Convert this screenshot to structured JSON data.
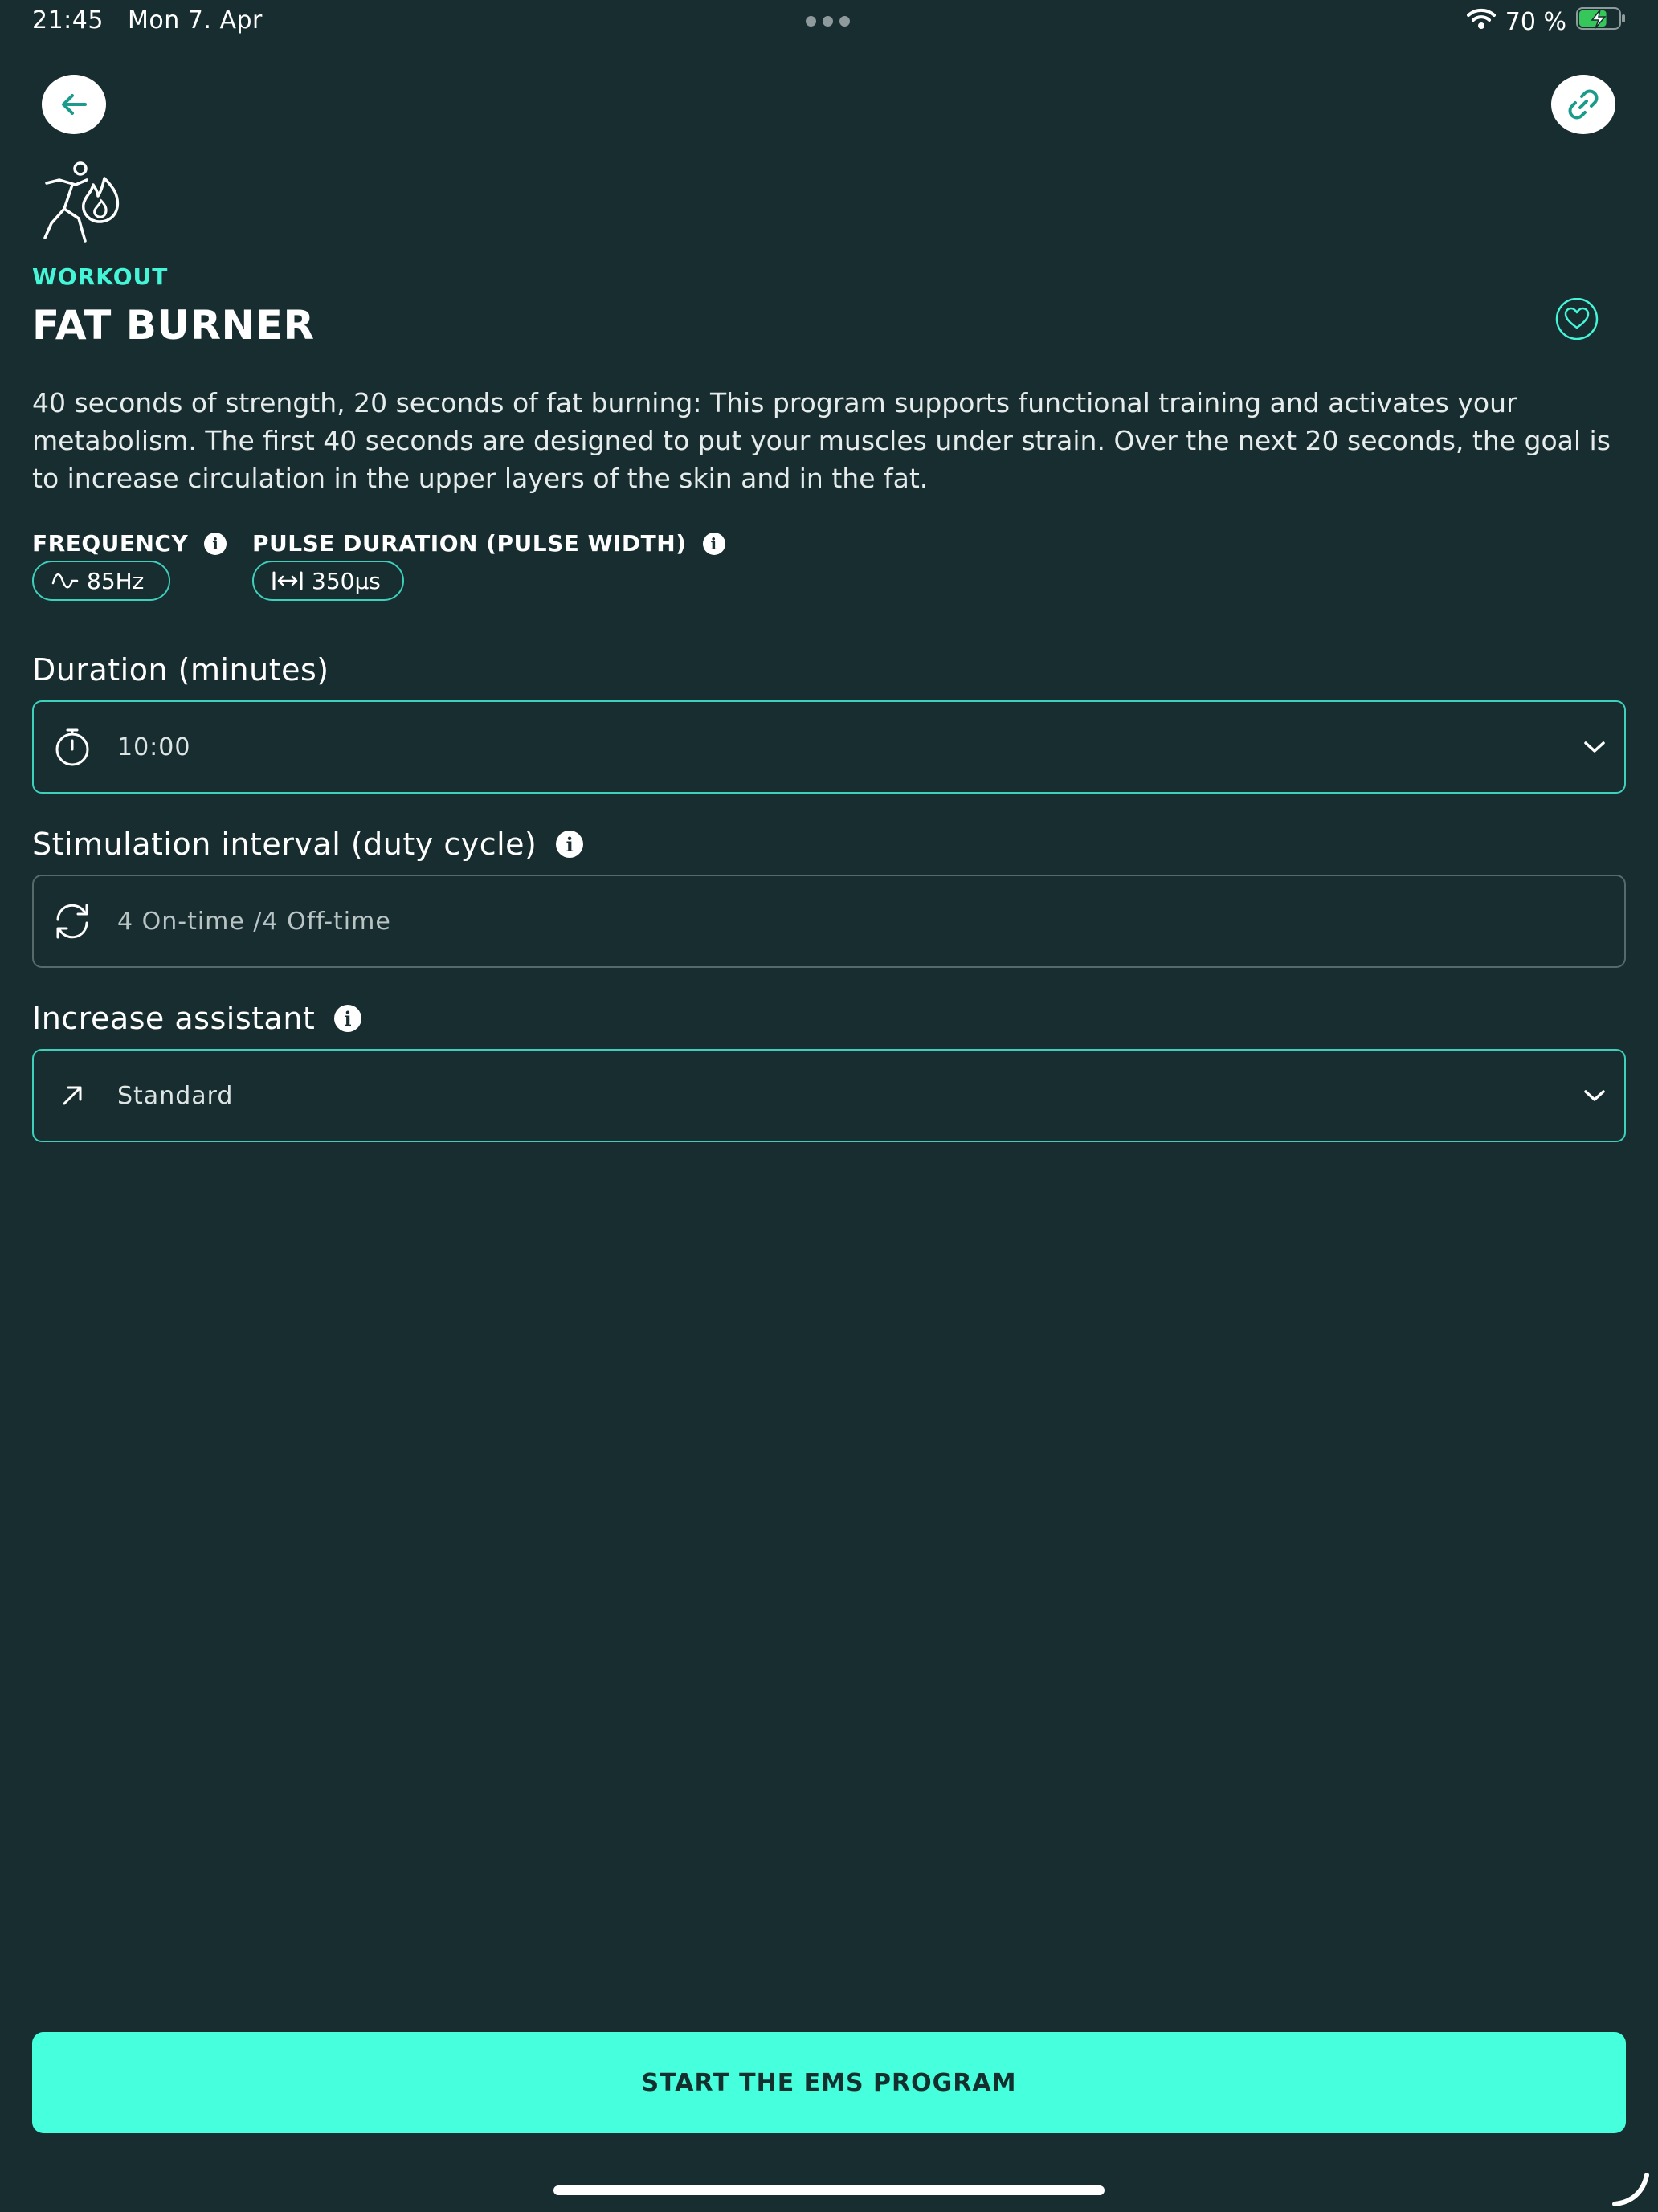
{
  "status_bar": {
    "time": "21:45",
    "date": "Mon 7. Apr",
    "battery_percent": "70 %",
    "battery_level": 0.7,
    "icons": [
      "wifi-icon",
      "battery-charging-icon"
    ]
  },
  "header": {
    "back_icon": "arrow-left-icon",
    "share_icon": "link-icon",
    "program_icon": "runner-fire-icon"
  },
  "program": {
    "category": "WORKOUT",
    "title": "FAT BURNER",
    "favorite_icon": "heart-icon",
    "description": "40 seconds of strength, 20 seconds of fat burning: This program supports functional training and activates your metabolism. The first 40 seconds are designed to put your muscles under strain. Over the next 20 seconds, the goal is to increase circulation in the upper layers of the skin and in the fat."
  },
  "parameters": {
    "frequency": {
      "label": "FREQUENCY",
      "value": "85Hz",
      "icon": "sine-wave-icon"
    },
    "pulse": {
      "label": "PULSE DURATION (PULSE WIDTH)",
      "value": "350µs",
      "icon": "pulse-width-icon"
    }
  },
  "settings": {
    "duration": {
      "label": "Duration (minutes)",
      "value": "10:00",
      "icon": "stopwatch-icon"
    },
    "interval": {
      "label": "Stimulation interval (duty cycle)",
      "value": "4 On-time /4 Off-time",
      "icon": "refresh-icon"
    },
    "assistant": {
      "label": "Increase assistant",
      "value": "Standard",
      "icon": "arrow-up-right-icon"
    }
  },
  "actions": {
    "start_label": "START THE EMS PROGRAM"
  },
  "colors": {
    "background": "#172d30",
    "accent": "#45f5d8",
    "button": "#45ffdd"
  }
}
